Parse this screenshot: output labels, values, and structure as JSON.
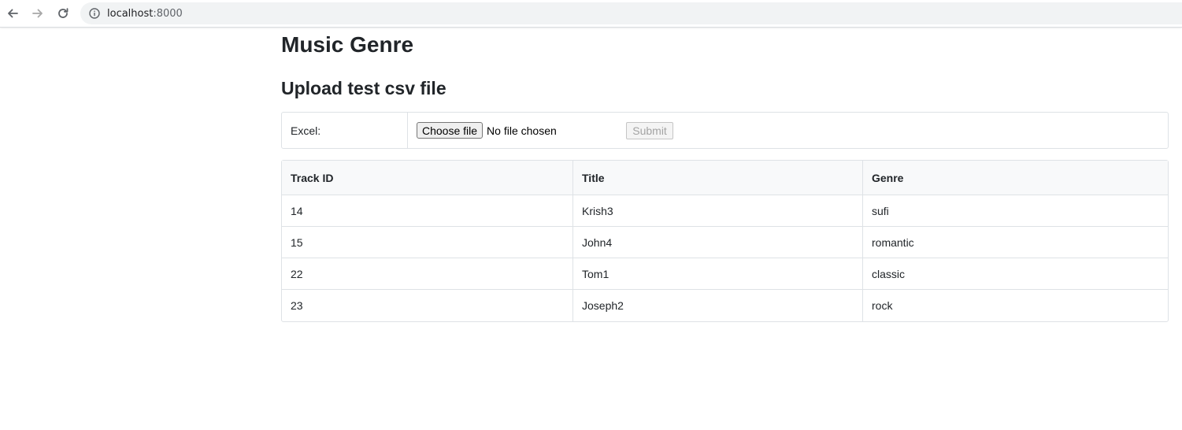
{
  "browser": {
    "url_host": "localhost",
    "url_port": ":8000",
    "icons": [
      "back-arrow-icon",
      "forward-arrow-icon",
      "reload-icon",
      "info-icon"
    ]
  },
  "page": {
    "title": "Music Genre",
    "section_title": "Upload test csv file"
  },
  "upload_form": {
    "label": "Excel:",
    "choose_file_label": "Choose file",
    "file_status": "No file chosen",
    "submit_label": "Submit"
  },
  "tracks_table": {
    "headers": [
      "Track ID",
      "Title",
      "Genre"
    ],
    "rows": [
      [
        "14",
        "Krish3",
        "sufi"
      ],
      [
        "15",
        "John4",
        "romantic"
      ],
      [
        "22",
        "Tom1",
        "classic"
      ],
      [
        "23",
        "Joseph2",
        "rock"
      ]
    ]
  }
}
